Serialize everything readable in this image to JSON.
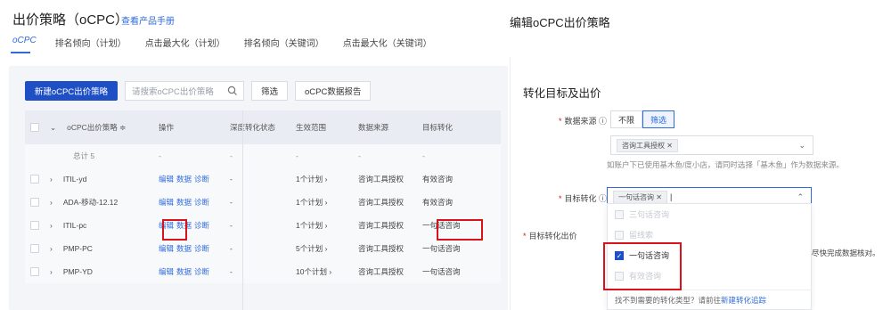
{
  "left": {
    "title": "出价策略（oCPC）",
    "help_link": "查看产品手册",
    "tabs": [
      "oCPC",
      "排名倾向（计划）",
      "点击最大化（计划）",
      "排名倾向（关键词）",
      "点击最大化（关键词）"
    ],
    "toolbar": {
      "new_button": "新建oCPC出价策略",
      "search_placeholder": "请搜索oCPC出价策略",
      "filter_button": "筛选",
      "report_button": "oCPC数据报告"
    },
    "table": {
      "headers": [
        "oCPC出价策略 ≑",
        "操作",
        "深度转化状态",
        "生效范围",
        "数据来源",
        "目标转化"
      ],
      "total": {
        "label": "总计 5",
        "dash": "-"
      },
      "rows": [
        {
          "name": "ITIL-yd",
          "actions": [
            "编辑",
            "数据",
            "诊断"
          ],
          "deep": "-",
          "scope": "1个计划 ›",
          "source": "咨询工具授权",
          "target": "有效咨询"
        },
        {
          "name": "ADA-移动-12.12",
          "actions": [
            "编辑",
            "数据",
            "诊断"
          ],
          "deep": "-",
          "scope": "1个计划 ›",
          "source": "咨询工具授权",
          "target": "有效咨询"
        },
        {
          "name": "ITIL-pc",
          "actions": [
            "编辑",
            "数据",
            "诊断"
          ],
          "deep": "-",
          "scope": "1个计划 ›",
          "source": "咨询工具授权",
          "target": "一句话咨询"
        },
        {
          "name": "PMP-PC",
          "actions": [
            "编辑",
            "数据",
            "诊断"
          ],
          "deep": "-",
          "scope": "5个计划 ›",
          "source": "咨询工具授权",
          "target": "一句话咨询"
        },
        {
          "name": "PMP-YD",
          "actions": [
            "编辑",
            "数据",
            "诊断"
          ],
          "deep": "-",
          "scope": "10个计划 ›",
          "source": "咨询工具授权",
          "target": "一句话咨询"
        }
      ]
    }
  },
  "right": {
    "title": "编辑oCPC出价策略",
    "section_title": "转化目标及出价",
    "data_source_label": "数据来源",
    "data_source_options": [
      "不限",
      "筛选"
    ],
    "data_source_tag": "咨询工具授权",
    "hint": "如账户下已使用基木鱼/度小店，请同时选择「基木鱼」作为数据来源。",
    "target_label": "目标转化",
    "target_tag": "一句话咨询",
    "bid_label": "目标转化出价",
    "dropdown_items": [
      {
        "label": "三句话咨询",
        "checked": false
      },
      {
        "label": "留线索",
        "checked": false
      },
      {
        "label": "一句话咨询",
        "checked": true
      },
      {
        "label": "有效咨询",
        "checked": false
      }
    ],
    "dropdown_footer_text": "找不到需要的转化类型？请前往",
    "dropdown_footer_link": "新建转化追踪",
    "side_note": "尽快完成数据核对。"
  }
}
